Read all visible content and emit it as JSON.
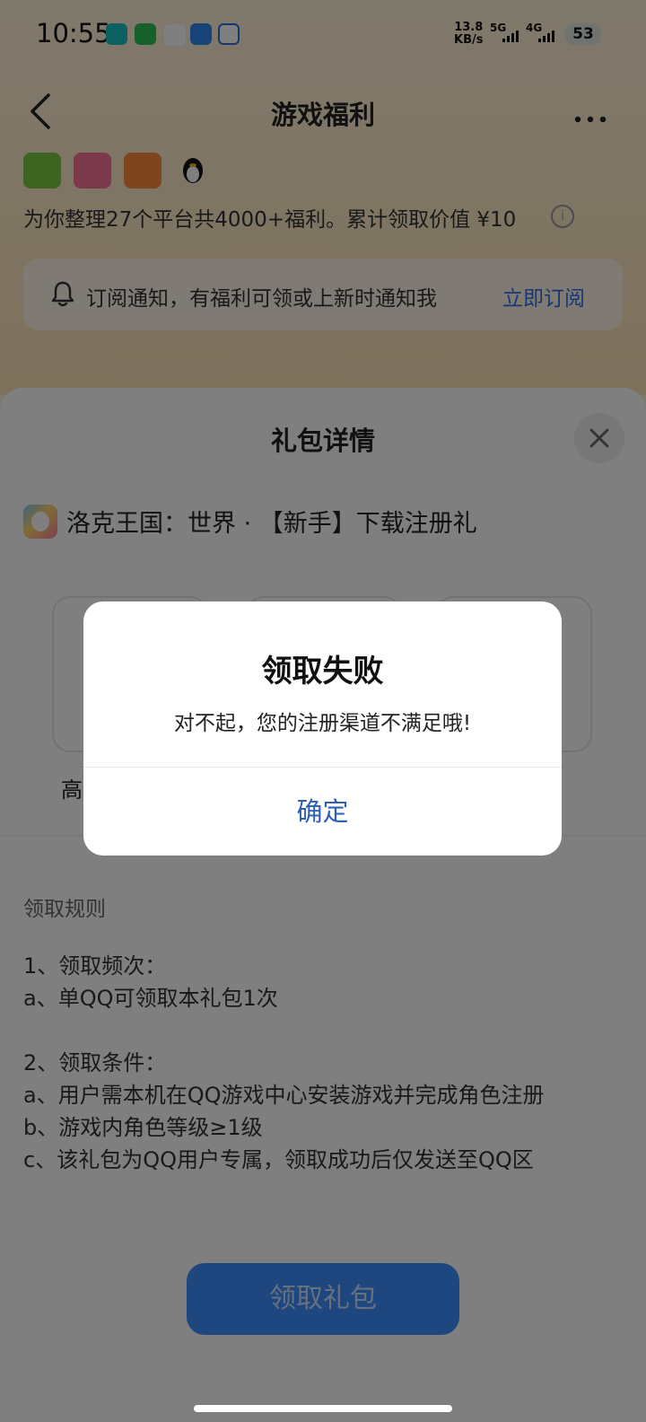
{
  "status_bar": {
    "time": "10:55",
    "net_speed_value": "13.8",
    "net_speed_unit": "KB/s",
    "signal1_label": "5G",
    "signal2_label": "4G",
    "battery": "53",
    "app_icons": [
      "taptap-icon",
      "wechat-icon",
      "app-icon",
      "message-icon",
      "chat-icon"
    ]
  },
  "nav": {
    "title": "游戏福利"
  },
  "background": {
    "info_text": "为你整理27个平台共4000+福利。累计领取价值 ¥10",
    "info_icon": "i",
    "subscribe_text": "订阅通知，有福利可领或上新时通知我",
    "subscribe_button": "立即订阅"
  },
  "sheet": {
    "title": "礼包详情",
    "game_name": "洛克王国：世界 · 【新手】下载注册礼",
    "gift_label_partial": "高",
    "rules_title": "领取规则",
    "rules": [
      "1、领取频次：",
      "a、单QQ可领取本礼包1次",
      "2、领取条件：",
      "a、用户需本机在QQ游戏中心安装游戏并完成角色注册",
      "b、游戏内角色等级≥1级",
      "c、该礼包为QQ用户专属，领取成功后仅发送至QQ区"
    ],
    "claim_button": "领取礼包"
  },
  "dialog": {
    "title": "领取失败",
    "message": "对不起，您的注册渠道不满足哦!",
    "confirm": "确定"
  },
  "colors": {
    "accent_blue": "#3c8cff",
    "link_blue": "#2c5fb8",
    "background_warm": "#fdf3e1"
  }
}
